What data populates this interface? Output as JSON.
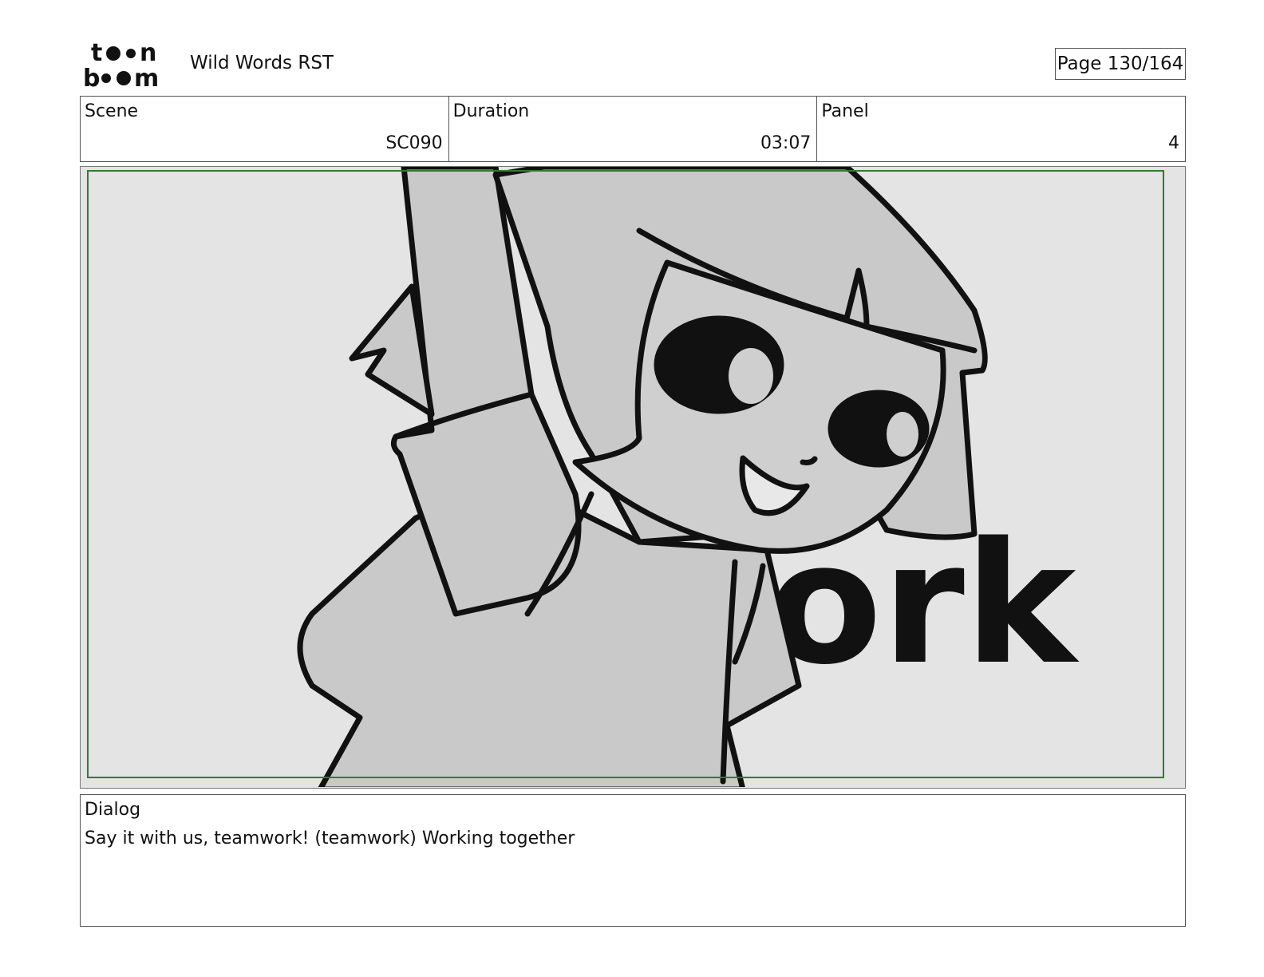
{
  "header": {
    "logo_text": "toon boom",
    "project_title": "Wild Words RST",
    "page_counter": "Page 130/164"
  },
  "info": {
    "scene": {
      "label": "Scene",
      "value": "SC090"
    },
    "duration": {
      "label": "Duration",
      "value": "03:07"
    },
    "panel": {
      "label": "Panel",
      "value": "4"
    }
  },
  "panel_image": {
    "background_text": "ork",
    "safe_frame_color": "#2e7d32"
  },
  "dialog": {
    "label": "Dialog",
    "text": "Say it with us, teamwork! (teamwork) Working together"
  }
}
